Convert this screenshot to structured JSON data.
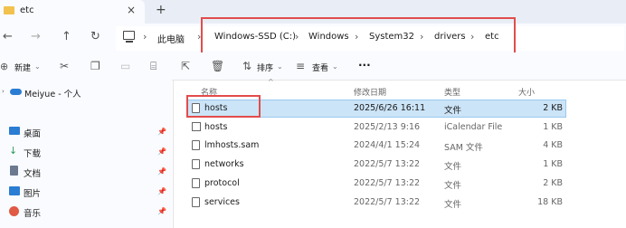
{
  "tab": {
    "title": "etc",
    "close": "×",
    "new": "+"
  },
  "nav": {
    "back": "←",
    "forward": "→",
    "up": "↑",
    "refresh": "↻"
  },
  "breadcrumb": {
    "items": [
      "此电脑",
      "Windows-SSD (C:)",
      "Windows",
      "System32",
      "drivers",
      "etc"
    ],
    "sep": "›"
  },
  "toolbar": {
    "new_label": "新建",
    "sort_label": "排序",
    "view_label": "查看",
    "more": "···"
  },
  "sidebar": {
    "cloud_label": "Meiyue - 个人",
    "items": [
      {
        "label": "桌面",
        "icon": "desktop-icon",
        "color": "#2b7cd3"
      },
      {
        "label": "下载",
        "icon": "download-icon",
        "color": "#2b9a5a"
      },
      {
        "label": "文档",
        "icon": "document-icon",
        "color": "#6b7a8f"
      },
      {
        "label": "图片",
        "icon": "picture-icon",
        "color": "#2b7cd3"
      },
      {
        "label": "音乐",
        "icon": "music-icon",
        "color": "#e05a44"
      }
    ]
  },
  "columns": {
    "name": "名称",
    "date": "修改日期",
    "type": "类型",
    "size": "大小"
  },
  "files": [
    {
      "name": "hosts",
      "date": "2025/6/26 16:11",
      "type": "文件",
      "size": "2 KB",
      "selected": true
    },
    {
      "name": "hosts",
      "date": "2025/2/13 9:16",
      "type": "iCalendar File",
      "size": "1 KB",
      "selected": false
    },
    {
      "name": "lmhosts.sam",
      "date": "2024/4/1 15:24",
      "type": "SAM 文件",
      "size": "4 KB",
      "selected": false
    },
    {
      "name": "networks",
      "date": "2022/5/7 13:22",
      "type": "文件",
      "size": "1 KB",
      "selected": false
    },
    {
      "name": "protocol",
      "date": "2022/5/7 13:22",
      "type": "文件",
      "size": "2 KB",
      "selected": false
    },
    {
      "name": "services",
      "date": "2022/5/7 13:22",
      "type": "文件",
      "size": "18 KB",
      "selected": false
    }
  ],
  "colors": {
    "highlight": "#e24c4c",
    "selection": "#cce4f7"
  }
}
